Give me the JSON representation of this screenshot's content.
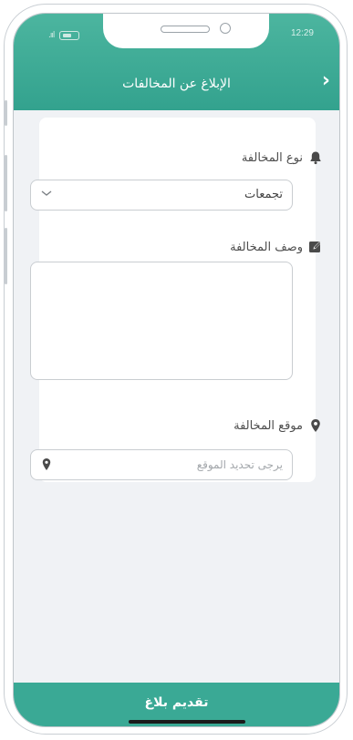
{
  "status": {
    "time": "12:29",
    "signal": ".ııl"
  },
  "header": {
    "title": "الإبلاغ عن المخالفات",
    "back_icon": "chevron-right-icon"
  },
  "form": {
    "type_label": "نوع المخالفة",
    "type_icon": "bell-icon",
    "type_value": "تجمعات",
    "desc_label": "وصف المخالفة",
    "desc_icon": "edit-icon",
    "desc_value": "",
    "location_label": "موقع المخالفة",
    "location_icon": "location-pin-icon",
    "location_placeholder": "يرجى تحديد الموقع"
  },
  "footer": {
    "submit_label": "تقديم بلاغ"
  },
  "colors": {
    "primary": "#3aa995",
    "header_top": "#4cb59f",
    "background": "#f0f2f5"
  }
}
